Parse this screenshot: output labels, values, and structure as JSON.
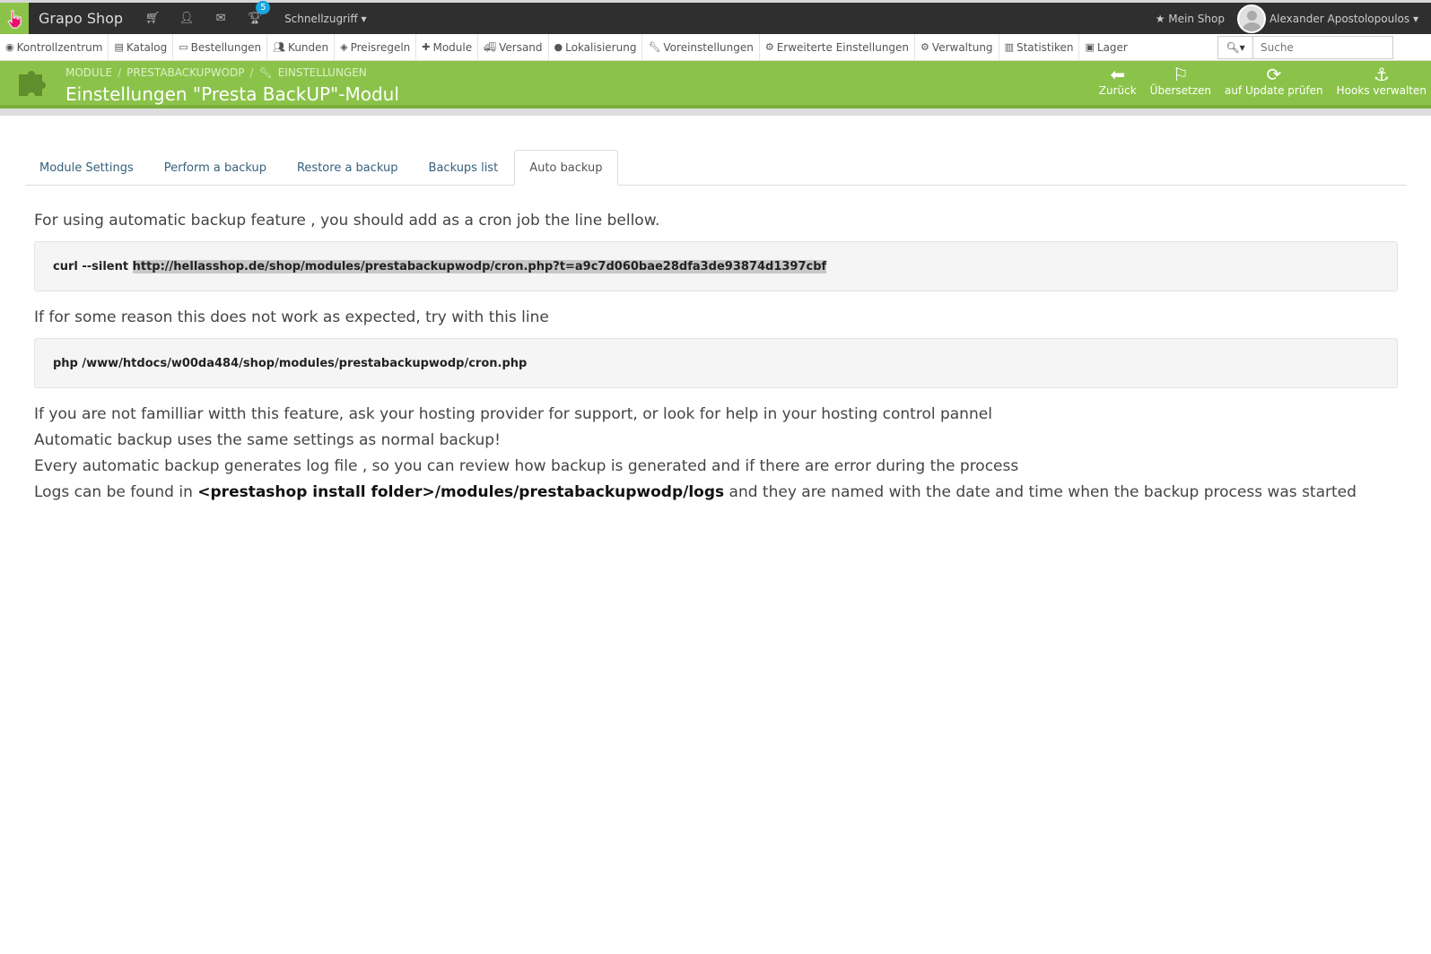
{
  "topbar": {
    "shop_name": "Grapo Shop",
    "notif_count": "5",
    "quick_access": "Schnellzugriff",
    "my_shop": "Mein Shop",
    "user": "Alexander Apostolopoulos"
  },
  "nav": {
    "items": [
      {
        "label": "Kontrollzentrum",
        "icon": "dashboard-icon"
      },
      {
        "label": "Katalog",
        "icon": "book-icon"
      },
      {
        "label": "Bestellungen",
        "icon": "credit-card-icon"
      },
      {
        "label": "Kunden",
        "icon": "users-icon"
      },
      {
        "label": "Preisregeln",
        "icon": "tags-icon"
      },
      {
        "label": "Module",
        "icon": "puzzle-icon"
      },
      {
        "label": "Versand",
        "icon": "truck-icon"
      },
      {
        "label": "Lokalisierung",
        "icon": "globe-icon"
      },
      {
        "label": "Voreinstellungen",
        "icon": "wrench-icon"
      },
      {
        "label": "Erweiterte Einstellungen",
        "icon": "cogs-icon"
      },
      {
        "label": "Verwaltung",
        "icon": "gear-icon"
      },
      {
        "label": "Statistiken",
        "icon": "bar-chart-icon"
      },
      {
        "label": "Lager",
        "icon": "archive-icon"
      }
    ],
    "search_placeholder": "Suche"
  },
  "header": {
    "breadcrumb": [
      "MODULE",
      "PRESTABACKUPWODP",
      "EINSTELLUNGEN"
    ],
    "title": "Einstellungen \"Presta BackUP\"-Modul",
    "tools": [
      {
        "label": "Zurück",
        "icon": "arrow-left-circle-icon"
      },
      {
        "label": "Übersetzen",
        "icon": "flag-icon"
      },
      {
        "label": "auf Update prüfen",
        "icon": "refresh-icon"
      },
      {
        "label": "Hooks verwalten",
        "icon": "anchor-icon"
      }
    ]
  },
  "tabs": [
    "Module Settings",
    "Perform a backup",
    "Restore a backup",
    "Backups list",
    "Auto backup"
  ],
  "active_tab": "Auto backup",
  "content": {
    "intro": "For using automatic backup feature , you should add as a cron job the line bellow.",
    "cmd1_prefix": "curl --silent ",
    "cmd1_url": "http://hellasshop.de/shop/modules/prestabackupwodp/cron.php?t=a9c7d060bae28dfa3de93874d1397cbf",
    "alt_intro": "If for some reason this does not work as expected, try with this line",
    "cmd2": "php /www/htdocs/w00da484/shop/modules/prestabackupwodp/cron.php",
    "note1": "If you are not familliar witth this feature, ask your hosting provider for support, or look for help in your hosting control pannel",
    "note2": "Automatic backup uses the same settings as normal backup!",
    "note3": "Every automatic backup generates log file , so you can review how backup is generated and if there are error during the process",
    "note4_prefix": "Logs can be found in ",
    "note4_path": "<prestashop install folder>/modules/prestabackupwodp/logs",
    "note4_suffix": " and they are named with the date and time when the backup process was started"
  }
}
